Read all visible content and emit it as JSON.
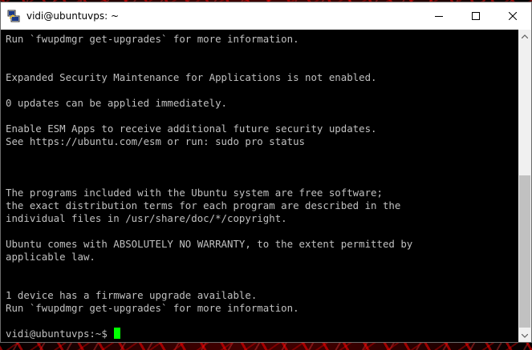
{
  "window": {
    "title": "vidi@ubuntuvps: ~",
    "app_icon": "putty-icon",
    "controls": [
      "minimize-icon",
      "maximize-icon",
      "close-icon"
    ]
  },
  "terminal": {
    "lines": [
      "Run `fwupdmgr get-upgrades` for more information.",
      "",
      "",
      "Expanded Security Maintenance for Applications is not enabled.",
      "",
      "0 updates can be applied immediately.",
      "",
      "Enable ESM Apps to receive additional future security updates.",
      "See https://ubuntu.com/esm or run: sudo pro status",
      "",
      "",
      "",
      "The programs included with the Ubuntu system are free software;",
      "the exact distribution terms for each program are described in the",
      "individual files in /usr/share/doc/*/copyright.",
      "",
      "Ubuntu comes with ABSOLUTELY NO WARRANTY, to the extent permitted by",
      "applicable law.",
      "",
      "",
      "1 device has a firmware upgrade available.",
      "Run `fwupdmgr get-upgrades` for more information.",
      ""
    ],
    "prompt": "vidi@ubuntuvps:~$ ",
    "text_color": "#c0c0c0",
    "cursor_color": "#00ff00"
  }
}
